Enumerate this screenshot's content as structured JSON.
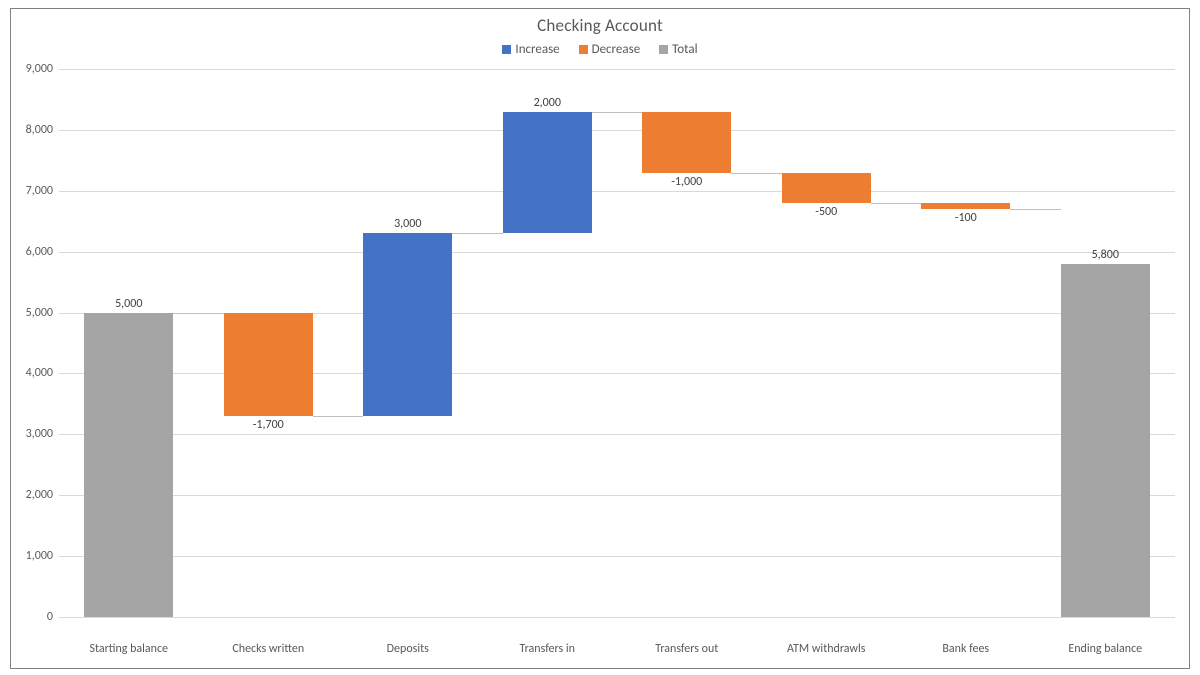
{
  "chart_data": {
    "type": "bar",
    "subtype": "waterfall",
    "title": "Checking Account",
    "xlabel": "",
    "ylabel": "",
    "ylim": [
      0,
      9000
    ],
    "ystep": 1000,
    "legend": [
      {
        "name": "Increase",
        "key": "increase"
      },
      {
        "name": "Decrease",
        "key": "decrease"
      },
      {
        "name": "Total",
        "key": "total"
      }
    ],
    "colors": {
      "increase": "#4472C4",
      "decrease": "#ED7D31",
      "total": "#A5A5A5",
      "gridline": "#d9d9d9"
    },
    "categories": [
      "Starting balance",
      "Checks written",
      "Deposits",
      "Transfers in",
      "Transfers out",
      "ATM withdrawls",
      "Bank fees",
      "Ending balance"
    ],
    "items": [
      {
        "label": "Starting balance",
        "value": 5000,
        "type": "total"
      },
      {
        "label": "Checks written",
        "value": -1700,
        "type": "decrease"
      },
      {
        "label": "Deposits",
        "value": 3000,
        "type": "increase"
      },
      {
        "label": "Transfers in",
        "value": 2000,
        "type": "increase"
      },
      {
        "label": "Transfers out",
        "value": -1000,
        "type": "decrease"
      },
      {
        "label": "ATM withdrawls",
        "value": -500,
        "type": "decrease"
      },
      {
        "label": "Bank fees",
        "value": -100,
        "type": "decrease"
      },
      {
        "label": "Ending balance",
        "value": 5800,
        "type": "total"
      }
    ],
    "data_label_format": "#,##0"
  }
}
